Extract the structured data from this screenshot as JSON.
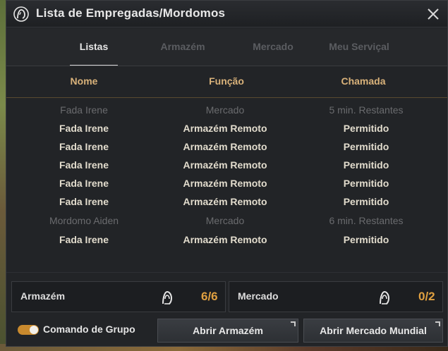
{
  "window": {
    "title": "Lista de Empregadas/Mordomos"
  },
  "tabs": [
    {
      "label": "Listas",
      "active": true
    },
    {
      "label": "Armazém",
      "active": false
    },
    {
      "label": "Mercado",
      "active": false
    },
    {
      "label": "Meu Serviçal",
      "active": false
    }
  ],
  "columns": {
    "name": "Nome",
    "role": "Função",
    "call": "Chamada"
  },
  "rows": [
    {
      "name": "Fada Irene",
      "role": "Mercado",
      "call": "5 min. Restantes",
      "available": false
    },
    {
      "name": "Fada Irene",
      "role": "Armazém Remoto",
      "call": "Permitido",
      "available": true
    },
    {
      "name": "Fada Irene",
      "role": "Armazém Remoto",
      "call": "Permitido",
      "available": true
    },
    {
      "name": "Fada Irene",
      "role": "Armazém Remoto",
      "call": "Permitido",
      "available": true
    },
    {
      "name": "Fada Irene",
      "role": "Armazém Remoto",
      "call": "Permitido",
      "available": true
    },
    {
      "name": "Fada Irene",
      "role": "Armazém Remoto",
      "call": "Permitido",
      "available": true
    },
    {
      "name": "Mordomo Aiden",
      "role": "Mercado",
      "call": "6 min. Restantes",
      "available": false
    },
    {
      "name": "Fada Irene",
      "role": "Armazém Remoto",
      "call": "Permitido",
      "available": true
    }
  ],
  "panels": {
    "warehouse": {
      "label": "Armazém",
      "count": "6/6"
    },
    "market": {
      "label": "Mercado",
      "count": "0/2"
    }
  },
  "footer": {
    "group_command_label": "Comando de Grupo",
    "group_command_on": true,
    "open_warehouse": "Abrir Armazém",
    "open_market": "Abrir Mercado Mundial"
  },
  "colors": {
    "accent": "#e0a040",
    "header_text": "#d9b27a",
    "toggle_on": "#c98a2e"
  },
  "icons": {
    "title": "maid-icon",
    "panel": "maid-icon",
    "close": "close-icon"
  }
}
